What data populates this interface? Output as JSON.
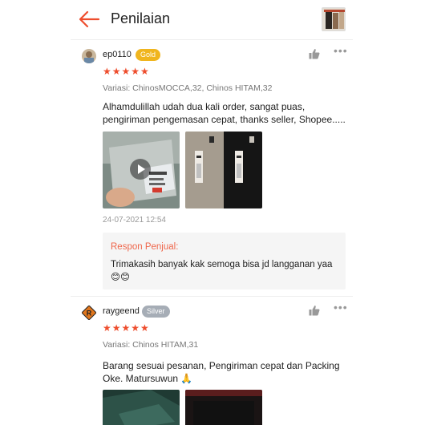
{
  "header": {
    "title": "Penilaian",
    "back_icon": "arrow-left-icon",
    "accent": "#ee4d2d"
  },
  "reviews": [
    {
      "username": "ep0110",
      "badge": "Gold",
      "rating": 5,
      "stars": "★★★★★",
      "variation": "Variasi: ChinosMOCCA,32, Chinos HITAM,32",
      "text": "Alhamdulillah udah dua kali order, sangat puas, pengiriman pengemasan cepat, thanks seller, Shopee.....",
      "timestamp": "24-07-2021 12:54",
      "seller_response": {
        "label": "Respon Penjual:",
        "text": "Trimakasih banyak kak semoga bisa jd langganan yaa 😊😊"
      }
    },
    {
      "username": "raygeend",
      "badge": "Silver",
      "rating": 5,
      "stars": "★★★★★",
      "variation": "Variasi: Chinos HITAM,31",
      "text": "Barang sesuai pesanan, Pengiriman cepat dan Packing Oke. Matursuwun 🙏"
    }
  ],
  "colors": {
    "star": "#ee4d2d",
    "gold_badge": "#f0b51e",
    "silver_badge": "#a6adb6"
  }
}
